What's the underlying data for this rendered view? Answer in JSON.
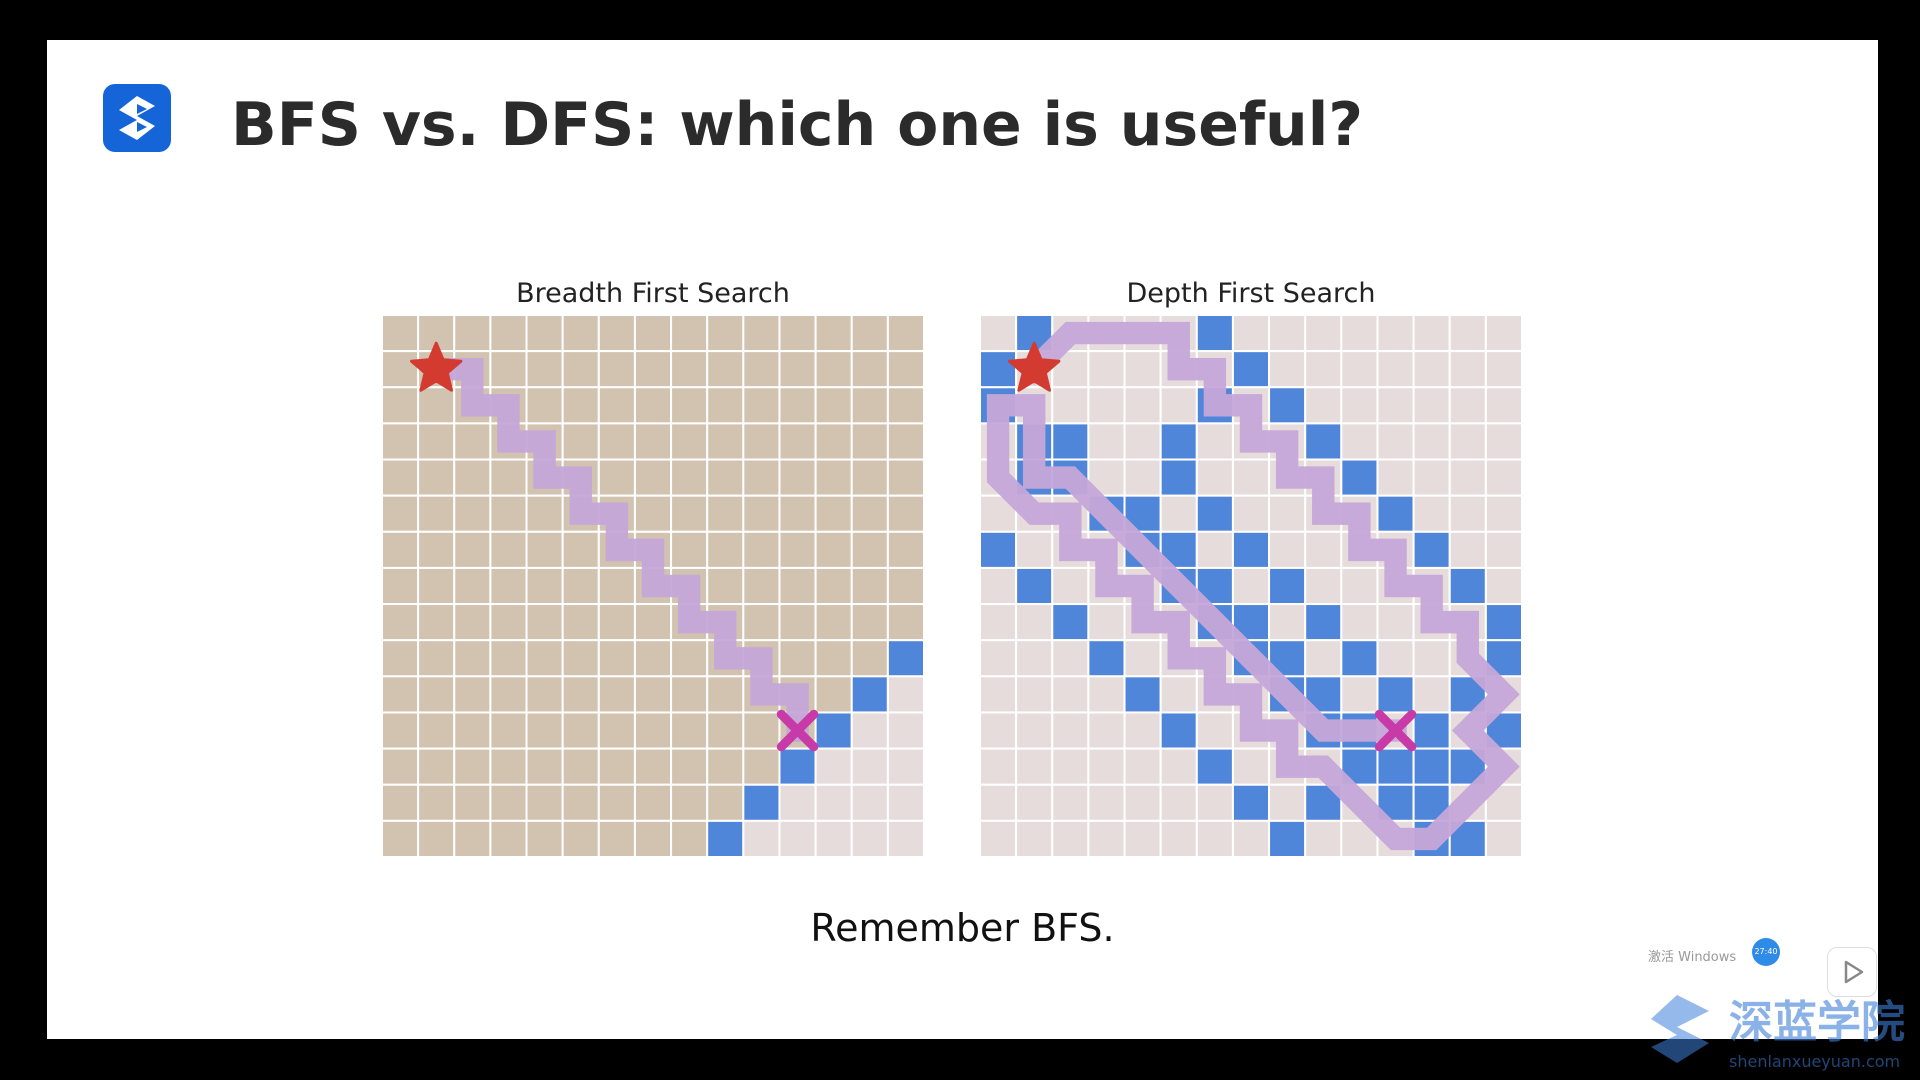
{
  "slide": {
    "title": "BFS vs. DFS: which one is useful?",
    "caption": "Remember BFS.",
    "logo_icon": "logo-s-icon"
  },
  "panels": [
    {
      "id": "bfs",
      "title": "Breadth First Search",
      "explored": "upper-left triangle",
      "frontier": [
        [
          8,
          15
        ],
        [
          9,
          14
        ],
        [
          10,
          13
        ],
        [
          11,
          12
        ],
        [
          12,
          11
        ],
        [
          13,
          10
        ],
        [
          14,
          9
        ]
      ],
      "path": [
        [
          1,
          1
        ],
        [
          1,
          2
        ],
        [
          2,
          2
        ],
        [
          2,
          3
        ],
        [
          3,
          3
        ],
        [
          3,
          4
        ],
        [
          4,
          4
        ],
        [
          4,
          5
        ],
        [
          5,
          5
        ],
        [
          5,
          6
        ],
        [
          6,
          6
        ],
        [
          6,
          7
        ],
        [
          7,
          7
        ],
        [
          7,
          8
        ],
        [
          8,
          8
        ],
        [
          8,
          9
        ],
        [
          9,
          9
        ],
        [
          9,
          10
        ],
        [
          10,
          10
        ],
        [
          10,
          11
        ],
        [
          11,
          11
        ]
      ],
      "start": [
        1,
        1
      ],
      "goal": [
        11,
        11
      ]
    },
    {
      "id": "dfs",
      "title": "Depth First Search",
      "explored": "path only",
      "frontier": [
        [
          1,
          0
        ],
        [
          2,
          0
        ],
        [
          3,
          1
        ],
        [
          3,
          2
        ],
        [
          4,
          1
        ],
        [
          4,
          5
        ],
        [
          5,
          6
        ],
        [
          6,
          7
        ],
        [
          7,
          8
        ],
        [
          8,
          9
        ],
        [
          9,
          10
        ],
        [
          10,
          11
        ],
        [
          11,
          12
        ],
        [
          12,
          12
        ],
        [
          13,
          12
        ],
        [
          14,
          13
        ],
        [
          0,
          6
        ],
        [
          1,
          7
        ],
        [
          2,
          8
        ],
        [
          3,
          9
        ],
        [
          4,
          10
        ],
        [
          5,
          11
        ],
        [
          6,
          12
        ],
        [
          7,
          13
        ],
        [
          8,
          14
        ],
        [
          9,
          14
        ],
        [
          10,
          13
        ],
        [
          11,
          14
        ],
        [
          12,
          13
        ],
        [
          14,
          8
        ],
        [
          13,
          9
        ],
        [
          15,
          12
        ],
        [
          3,
          5
        ],
        [
          2,
          6
        ],
        [
          4,
          2
        ],
        [
          5,
          3
        ],
        [
          6,
          4
        ],
        [
          7,
          5
        ],
        [
          8,
          6
        ],
        [
          9,
          7
        ],
        [
          10,
          8
        ],
        [
          11,
          9
        ],
        [
          12,
          10
        ],
        [
          13,
          11
        ],
        [
          14,
          12
        ],
        [
          6,
          0
        ],
        [
          7,
          1
        ],
        [
          8,
          2
        ],
        [
          9,
          3
        ],
        [
          10,
          4
        ],
        [
          11,
          5
        ],
        [
          12,
          6
        ],
        [
          13,
          7
        ],
        [
          5,
          4
        ],
        [
          6,
          5
        ],
        [
          7,
          6
        ],
        [
          8,
          7
        ],
        [
          9,
          8
        ],
        [
          10,
          9
        ],
        [
          11,
          10
        ],
        [
          12,
          11
        ],
        [
          0,
          1
        ]
      ],
      "path": [
        [
          1,
          1
        ],
        [
          0,
          2
        ],
        [
          0,
          3
        ],
        [
          0,
          4
        ],
        [
          0,
          5
        ],
        [
          1,
          5
        ],
        [
          1,
          6
        ],
        [
          2,
          6
        ],
        [
          2,
          7
        ],
        [
          3,
          7
        ],
        [
          3,
          8
        ],
        [
          4,
          8
        ],
        [
          4,
          9
        ],
        [
          5,
          9
        ],
        [
          5,
          10
        ],
        [
          6,
          10
        ],
        [
          6,
          11
        ],
        [
          7,
          11
        ],
        [
          7,
          12
        ],
        [
          8,
          12
        ],
        [
          8,
          13
        ],
        [
          9,
          13
        ],
        [
          10,
          14
        ],
        [
          11,
          13
        ],
        [
          12,
          14
        ],
        [
          13,
          13
        ],
        [
          14,
          12
        ],
        [
          14,
          11
        ],
        [
          13,
          10
        ],
        [
          12,
          9
        ],
        [
          12,
          8
        ],
        [
          11,
          8
        ],
        [
          11,
          7
        ],
        [
          10,
          7
        ],
        [
          10,
          6
        ],
        [
          9,
          6
        ],
        [
          9,
          5
        ],
        [
          8,
          5
        ],
        [
          8,
          4
        ],
        [
          7,
          4
        ],
        [
          7,
          3
        ],
        [
          6,
          3
        ],
        [
          6,
          2
        ],
        [
          5,
          2
        ],
        [
          5,
          1
        ],
        [
          4,
          0
        ],
        [
          3,
          0
        ],
        [
          2,
          0
        ],
        [
          2,
          1
        ],
        [
          3,
          1
        ],
        [
          4,
          1
        ],
        [
          4,
          2
        ],
        [
          5,
          3
        ],
        [
          6,
          4
        ],
        [
          7,
          5
        ],
        [
          8,
          6
        ],
        [
          9,
          7
        ],
        [
          10,
          8
        ],
        [
          11,
          9
        ],
        [
          11,
          10
        ],
        [
          11,
          11
        ]
      ],
      "start": [
        1,
        1
      ],
      "goal": [
        11,
        11
      ]
    }
  ],
  "grid": {
    "rows": 15,
    "cols": 15
  },
  "colors": {
    "explored": "#d2c2b0",
    "unexplored": "#e6dcdc",
    "frontier": "#4f86da",
    "path": "#c5a7d8",
    "start": "#d33b30",
    "goal": "#c83aa8",
    "gridline": "#ffffff",
    "logo": "#1565d8"
  },
  "watermark": {
    "text": "深蓝学院",
    "url": "shenlanxueyuan.com",
    "activate_note": "激活 Windows",
    "timer": "27:40"
  },
  "controls": {
    "play_icon": "play-icon"
  }
}
